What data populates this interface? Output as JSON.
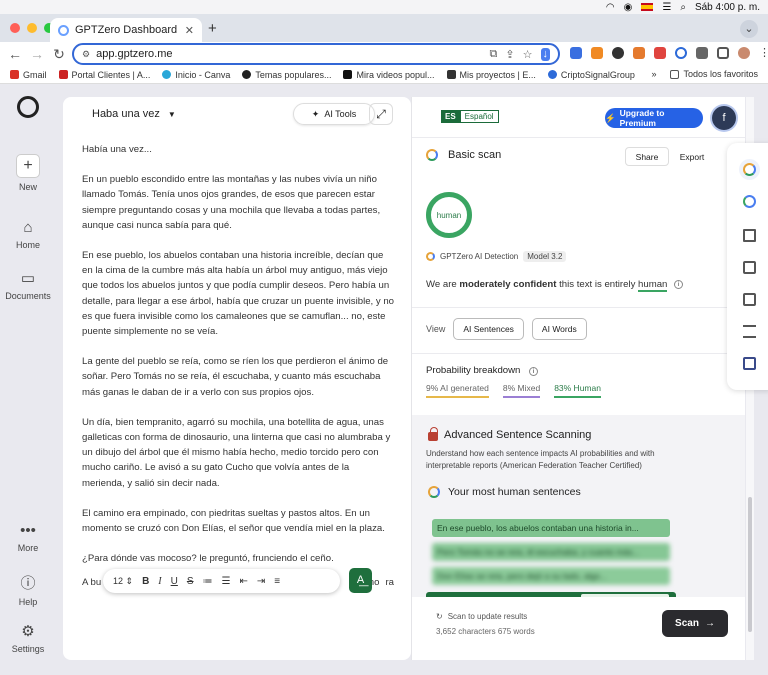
{
  "menubar": {
    "datetime": "Sáb 4:00 p. m."
  },
  "browser": {
    "tab_title": "GPTZero Dashboard",
    "url": "app.gptzero.me",
    "bookmarks": [
      "Gmail",
      "Portal Clientes | A...",
      "Inicio - Canva",
      "Temas populares...",
      "Mira videos popul...",
      "Mis proyectos | E...",
      "CriptoSignalGroup"
    ],
    "bookmarks_more": "»",
    "all_favorites": "Todos los favoritos"
  },
  "nav": {
    "new": "New",
    "home": "Home",
    "documents": "Documents",
    "more": "More",
    "help": "Help",
    "settings": "Settings"
  },
  "editor": {
    "doc_title": "Haba una vez",
    "ai_tools": "AI Tools",
    "paragraphs": [
      "Había una vez...",
      "En un pueblo escondido entre las montañas y las nubes vivía un niño llamado Tomás. Tenía unos ojos grandes, de esos que parecen estar siempre preguntando cosas y una mochila que llevaba a todas partes, aunque casi nunca sabía para qué.",
      "En ese pueblo, los abuelos contaban una historia increíble, decían que en la cima de la cumbre más alta había un árbol muy antiguo, más viejo que todos los abuelos juntos y que podía cumplir deseos. Pero había un detalle, para llegar a ese árbol, había que cruzar un puente invisible, y no es que fuera invisible como los camaleones que se camuflan... no, este puente simplemente no se veía.",
      "La gente del pueblo se reía, como se ríen los que perdieron el ánimo de soñar. Pero Tomás no se reía, él escuchaba, y cuanto más escuchaba más ganas le daban de ir a verlo con sus propios ojos.",
      "Un día, bien tempranito, agarró su mochila, una botellita de agua, unas galleticas con forma de dinosaurio, una linterna que casi no alumbraba y un dibujo del árbol que él mismo había hecho, medio torcido pero con mucho cariño. Le avisó a su gato Cucho que volvía antes de la merienda, y salió sin decir nada.",
      "El camino era empinado, con piedritas sueltas y pastos altos. En un momento se cruzó con Don Elías, el señor que vendía miel en la plaza.",
      "¿Para dónde vas mocoso? le preguntó, frunciendo el ceño."
    ],
    "last_line_start": "A bu",
    "last_line_mid": "no",
    "last_line_end": "ra",
    "font_size": "12"
  },
  "panel": {
    "lang_code": "ES",
    "lang_name": "Español",
    "upgrade": "Upgrade to Premium",
    "avatar_initial": "f",
    "scan_title": "Basic scan",
    "share": "Share",
    "export": "Export",
    "gauge_label": "human",
    "detection_label": "GPTZero AI Detection",
    "model": "Model 3.2",
    "confidence_pre": "We are",
    "confidence_level": "moderately confident",
    "confidence_mid": "this text is entirely",
    "confidence_result": "human",
    "view_label": "View",
    "view_sentences": "AI Sentences",
    "view_words": "AI Words",
    "prob_title": "Probability breakdown",
    "prob_ai": "9% AI generated",
    "prob_mixed": "8% Mixed",
    "prob_human": "83% Human",
    "adv_title": "Advanced Sentence Scanning",
    "adv_desc": "Understand how each sentence impacts AI probabilities and with interpretable reports (American Federation Teacher Certified)",
    "most_human_title": "Your most human sentences",
    "sentences": [
      "En ese pueblo, los abuelos contaban una historia in...",
      "Pero Tomás no se reía, él escuchaba, y cuanto más...",
      "Don Elías se reía, pero dejó a su lado, algo..."
    ],
    "scan_update": "Scan to update results",
    "char_count": "3,652 characters 675 words",
    "scan_button": "Scan"
  },
  "colors": {
    "accent_blue": "#2662e5",
    "human_green": "#3aa562",
    "dark_green": "#1f6f3d",
    "ai_yellow": "#e6b84a",
    "mixed_purple": "#9b7fd4"
  }
}
